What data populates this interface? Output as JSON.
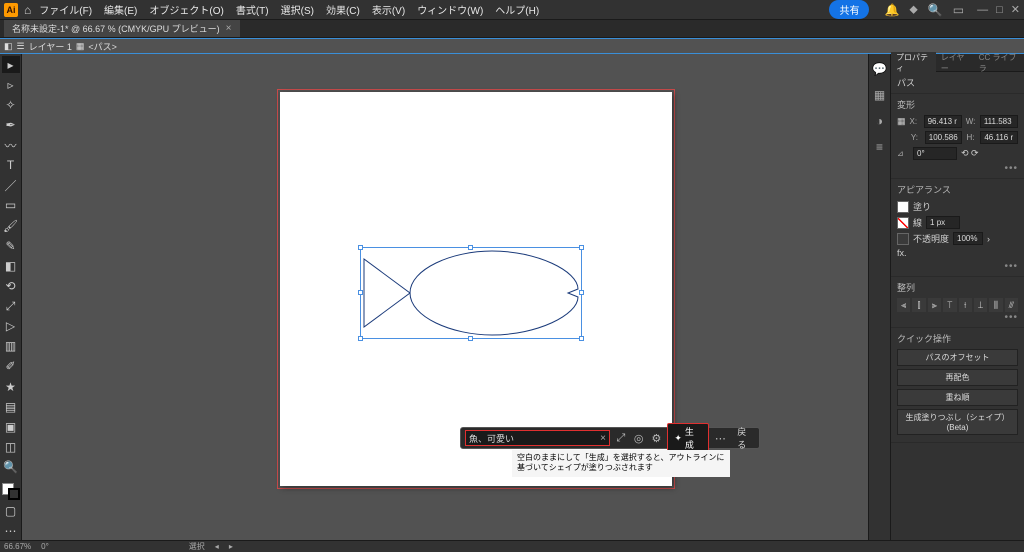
{
  "menubar": {
    "items": [
      "ファイル(F)",
      "編集(E)",
      "オブジェクト(O)",
      "書式(T)",
      "選択(S)",
      "効果(C)",
      "表示(V)",
      "ウィンドウ(W)",
      "ヘルプ(H)"
    ],
    "share": "共有"
  },
  "document": {
    "tab_title": "名称未設定-1* @ 66.67 % (CMYK/GPU プレビュー)"
  },
  "layerbar": {
    "layer": "レイヤー 1",
    "path_crumb": "<パス>"
  },
  "gen": {
    "prompt_value": "魚、可愛い",
    "gen_label": "生成",
    "back_label": "戻る",
    "tooltip": "空白のままにして「生成」を選択すると、アウトラインに基づいてシェイプが塗りつぶされます"
  },
  "props": {
    "tabs": [
      "プロパティ",
      "レイヤー",
      "CC ライブラ"
    ],
    "object_type": "パス",
    "transform_title": "変形",
    "x": "96.413 r",
    "y": "100.586",
    "w": "111.583",
    "h": "46.116 r",
    "angle": "0°",
    "flip": "⟲ ⟳",
    "appearance_title": "アピアランス",
    "fill_label": "塗り",
    "stroke_label": "線",
    "stroke_width": "1 px",
    "opacity_label": "不透明度",
    "opacity_value": "100%",
    "fx_label": "fx.",
    "align_title": "整列",
    "quick_title": "クイック操作",
    "quick_actions": [
      "パスのオフセット",
      "再配色",
      "重ね順",
      "生成塗りつぶし（シェイプ）(Beta)"
    ]
  },
  "status": {
    "zoom": "66.67%",
    "rotate": "0°",
    "sel": "選択"
  }
}
